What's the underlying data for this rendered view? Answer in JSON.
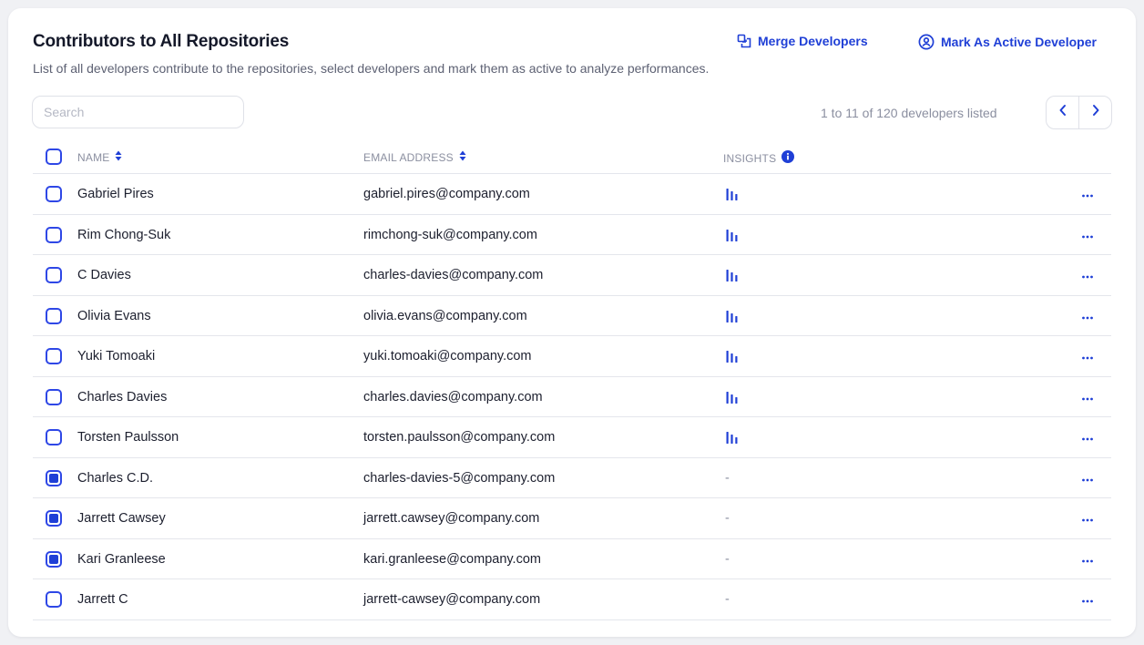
{
  "header": {
    "title": "Contributors to All Repositories",
    "subtitle": "List of all developers contribute to the repositories, select developers and mark them as active to analyze performances.",
    "merge_label": "Merge Developers",
    "mark_active_label": "Mark As Active Developer"
  },
  "search": {
    "placeholder": "Search",
    "value": ""
  },
  "pagination": {
    "summary": "1 to 11 of 120 developers listed"
  },
  "table": {
    "columns": {
      "name": "NAME",
      "email": "EMAIL ADDRESS",
      "insights": "INSIGHTS"
    },
    "rows": [
      {
        "name": "Gabriel Pires",
        "email": "gabriel.pires@company.com",
        "insights": "chart",
        "checked": false
      },
      {
        "name": "Rim Chong-Suk",
        "email": "rimchong-suk@company.com",
        "insights": "chart",
        "checked": false
      },
      {
        "name": "C Davies",
        "email": "charles-davies@company.com",
        "insights": "chart",
        "checked": false
      },
      {
        "name": "Olivia Evans",
        "email": "olivia.evans@company.com",
        "insights": "chart",
        "checked": false
      },
      {
        "name": "Yuki Tomoaki",
        "email": "yuki.tomoaki@company.com",
        "insights": "chart",
        "checked": false
      },
      {
        "name": "Charles Davies",
        "email": "charles.davies@company.com",
        "insights": "chart",
        "checked": false
      },
      {
        "name": "Torsten Paulsson",
        "email": "torsten.paulsson@company.com",
        "insights": "chart",
        "checked": false
      },
      {
        "name": "Charles C.D.",
        "email": "charles-davies-5@company.com",
        "insights": "-",
        "checked": true
      },
      {
        "name": "Jarrett Cawsey",
        "email": "jarrett.cawsey@company.com",
        "insights": "-",
        "checked": true
      },
      {
        "name": "Kari Granleese",
        "email": "kari.granleese@company.com",
        "insights": "-",
        "checked": true
      },
      {
        "name": "Jarrett C",
        "email": "jarrett-cawsey@company.com",
        "insights": "-",
        "checked": false
      }
    ]
  },
  "icons": {
    "merge": "merge-icon",
    "mark_active": "user-circle-icon",
    "sort": "sort-icon",
    "info": "info-icon",
    "insights": "bar-chart-icon",
    "more": "more-horizontal-icon",
    "prev": "chevron-left-icon",
    "next": "chevron-right-icon"
  },
  "colors": {
    "accent": "#1f3fd6",
    "muted_text": "#8b8fa0",
    "border": "#e4e6ec",
    "background": "#f0f1f4"
  }
}
